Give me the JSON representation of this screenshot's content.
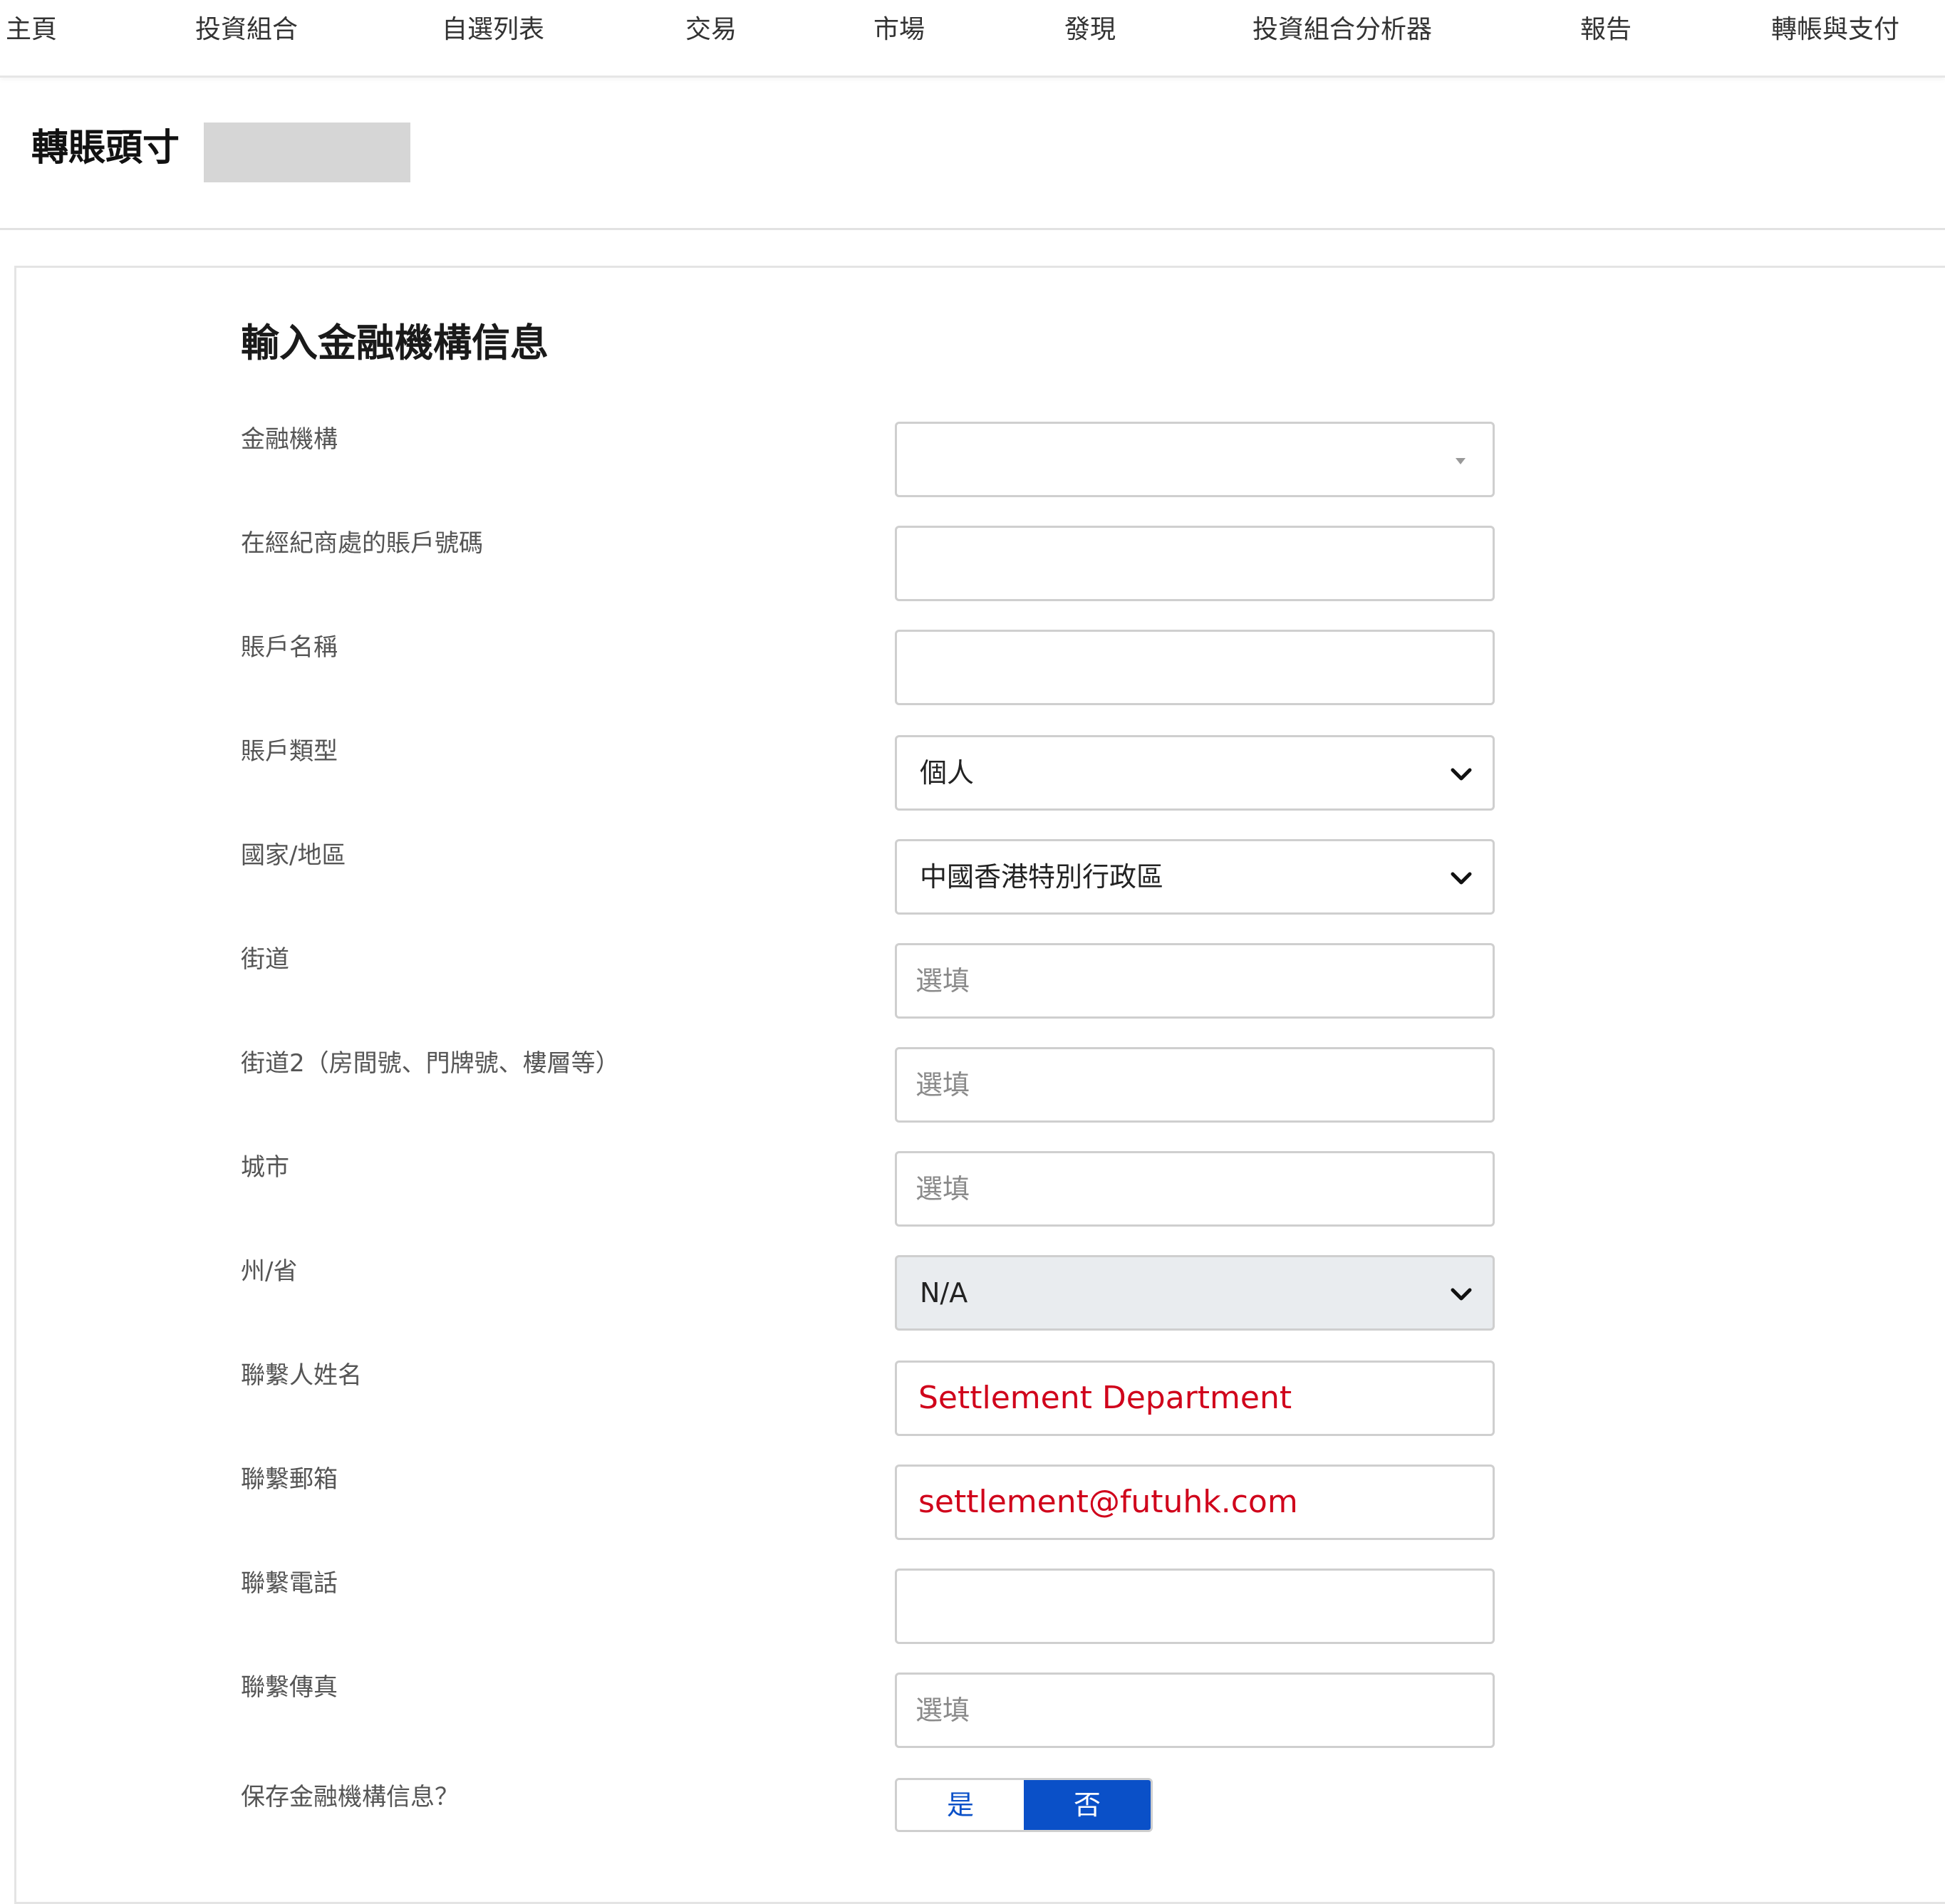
{
  "nav": {
    "items": [
      "主頁",
      "投資組合",
      "自選列表",
      "交易",
      "市場",
      "發現",
      "投資組合分析器",
      "報告",
      "轉帳與支付"
    ]
  },
  "page": {
    "title": "轉賬頭寸"
  },
  "form": {
    "title": "輸入金融機構信息",
    "fields": [
      {
        "label": "金融機構",
        "type": "select-empty",
        "value": ""
      },
      {
        "label": "在經紀商處的賬戶號碼",
        "type": "text",
        "value": ""
      },
      {
        "label": "賬戶名稱",
        "type": "text",
        "value": ""
      },
      {
        "label": "賬戶類型",
        "type": "select",
        "value": "個人"
      },
      {
        "label": "國家/地區",
        "type": "select",
        "value": "中國香港特別行政區"
      },
      {
        "label": "街道",
        "type": "text",
        "placeholder": "選填"
      },
      {
        "label": "街道2（房間號、門牌號、樓層等）",
        "type": "text",
        "placeholder": "選填"
      },
      {
        "label": "城市",
        "type": "text",
        "placeholder": "選填"
      },
      {
        "label": "州/省",
        "type": "select-disabled",
        "value": "N/A"
      },
      {
        "label": "聯繫人姓名",
        "type": "text",
        "value": "Settlement Department"
      },
      {
        "label": "聯繫郵箱",
        "type": "text",
        "value": "settlement@futuhk.com"
      },
      {
        "label": "聯繫電話",
        "type": "text",
        "value": ""
      },
      {
        "label": "聯繫傳真",
        "type": "text",
        "placeholder": "選填"
      }
    ],
    "save": {
      "label": "保存金融機構信息？",
      "yes": "是",
      "no": "否",
      "selected": "否"
    }
  },
  "colors": {
    "accent": "#0a50c8",
    "highlight_text": "#d0021b",
    "disabled_bg": "#e9ecef"
  }
}
